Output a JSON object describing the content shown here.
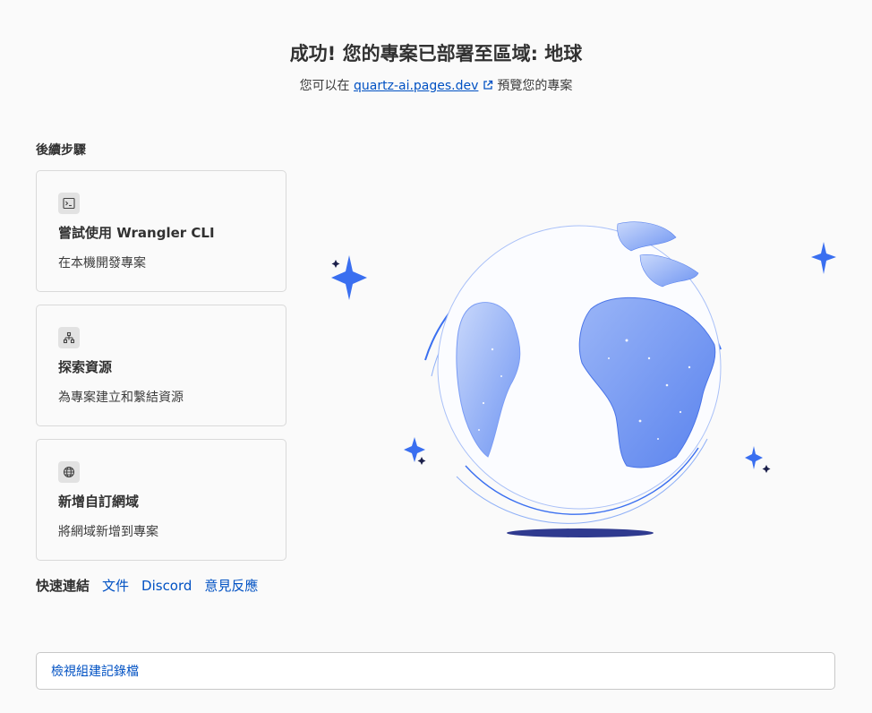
{
  "header": {
    "title": "成功! 您的專案已部署至區域: 地球",
    "subtitle_prefix": "您可以在",
    "link_text": "quartz-ai.pages.dev",
    "subtitle_suffix": "預覽您的專案"
  },
  "steps": {
    "heading": "後續步驟",
    "cards": [
      {
        "icon": "terminal-icon",
        "title": "嘗試使用 Wrangler CLI",
        "description": "在本機開發專案"
      },
      {
        "icon": "hierarchy-icon",
        "title": "探索資源",
        "description": "為專案建立和繫結資源"
      },
      {
        "icon": "globe-icon",
        "title": "新增自訂網域",
        "description": "將網域新增到專案"
      }
    ]
  },
  "quick_links": {
    "label": "快速連結",
    "links": [
      "文件",
      "Discord",
      "意見反應"
    ]
  },
  "build_log_button": "檢視組建記錄檔",
  "colors": {
    "link": "#0051c3",
    "globe_blue": "#7a9cf5",
    "sparkle_blue": "#3a6ff0",
    "shadow": "#2f3a8f"
  }
}
